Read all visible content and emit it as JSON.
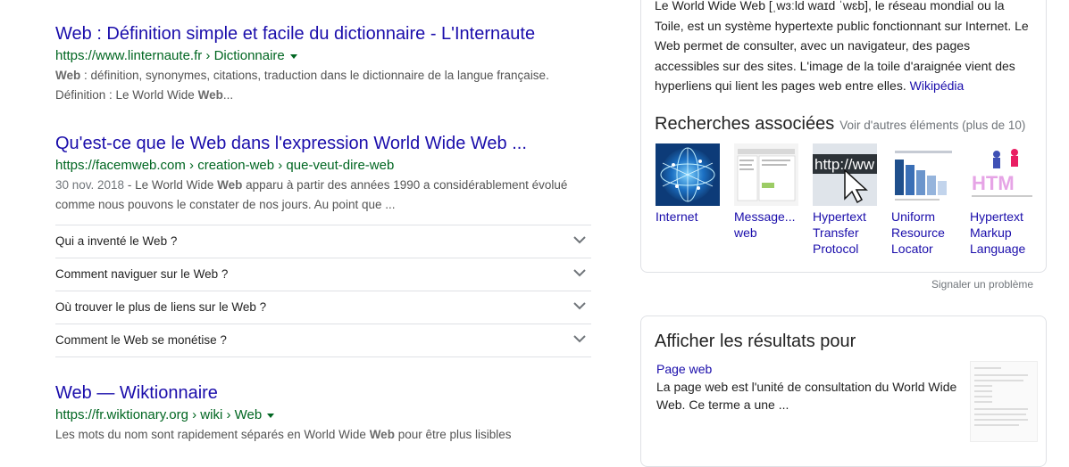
{
  "results": [
    {
      "title": "Web : Définition simple et facile du dictionnaire - L'Internaute",
      "url": "https://www.linternaute.fr › Dictionnaire",
      "snippet_line1_bold": "Web",
      "snippet_line1_rest": " : définition, synonymes, citations, traduction dans le dictionnaire de la langue française.",
      "snippet_line2_pre": "Définition : Le World Wide ",
      "snippet_line2_bold": "Web",
      "snippet_line2_post": "..."
    },
    {
      "title": "Qu'est-ce que le Web dans l'expression World Wide Web ...",
      "url": "https://facemweb.com › creation-web › que-veut-dire-web",
      "date": "30 nov. 2018",
      "snippet_line1_pre": " - Le World Wide ",
      "snippet_line1_bold": "Web",
      "snippet_line1_post": " apparu à partir des années 1990 a considérablement évolué",
      "snippet_line2": "comme nous pouvons le constater de nos jours. Au point que ..."
    },
    {
      "title": "Web — Wiktionnaire",
      "url": "https://fr.wiktionary.org › wiki › Web",
      "snippet_pre": "Les mots du nom sont rapidement séparés en World Wide ",
      "snippet_bold": "Web",
      "snippet_post": " pour être plus lisibles"
    }
  ],
  "people_also_ask": [
    "Qui a inventé le Web ?",
    "Comment naviguer sur le Web ?",
    "Où trouver le plus de liens sur le Web ?",
    "Comment le Web se monétise ?"
  ],
  "knowledge_panel": {
    "desc_line1": "Le World Wide Web [ˌwɜːld waɪd ˈwɛb], le réseau mondial ou la",
    "desc_line2": "Toile, est un système hypertexte public fonctionnant sur Internet. Le",
    "desc_line3": "Web permet de consulter, avec un navigateur, des pages",
    "desc_line4": "accessibles sur des sites. L'image de la toile d'araignée vient des",
    "desc_line5": "hyperliens qui lient les pages web entre elles. ",
    "source": "Wikipédia",
    "related_title": "Recherches associées",
    "related_more": "Voir d'autres éléments (plus de 10)",
    "related": [
      {
        "line1": "Internet",
        "line2": "",
        "line3": "",
        "icon": "globe-network-icon"
      },
      {
        "line1": "Message...",
        "line2": "web",
        "line3": "",
        "icon": "screenshot-icon"
      },
      {
        "line1": "Hypertext",
        "line2": "Transfer",
        "line3": "Protocol",
        "icon": "http-cursor-icon"
      },
      {
        "line1": "Uniform",
        "line2": "Resource",
        "line3": "Locator",
        "icon": "url-diagram-icon"
      },
      {
        "line1": "Hypertext",
        "line2": "Markup",
        "line3": "Language",
        "icon": "html-icon"
      }
    ],
    "report": "Signaler un problème"
  },
  "results_for": {
    "title": "Afficher les résultats pour",
    "link": "Page web",
    "text_line1": "La page web est l'unité de consultation du World Wide",
    "text_line2": "Web. Ce terme a une ..."
  },
  "colors": {
    "link": "#1a0dab",
    "url": "#006621",
    "snippet": "#545454",
    "border": "#dfe1e5"
  }
}
